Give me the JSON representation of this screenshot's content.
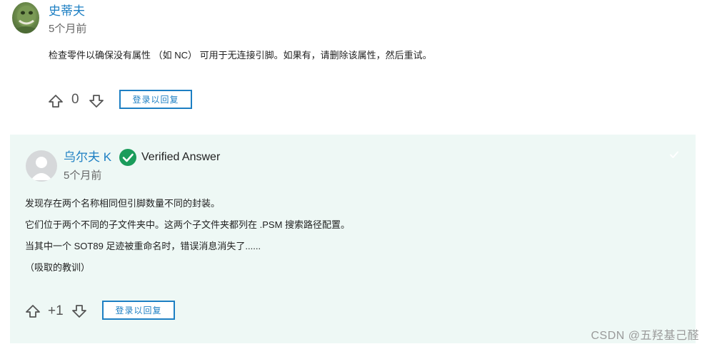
{
  "post1": {
    "author": "史蒂夫",
    "time": "5个月前",
    "body": "检查零件以确保没有属性 （如 NC） 可用于无连接引脚。如果有，请删除该属性，然后重试。",
    "votes": "0",
    "reply_label": "登录以回复"
  },
  "post2": {
    "author": "乌尔夫 K",
    "verified_label": "Verified Answer",
    "time": "5个月前",
    "lines": [
      "发现存在两个名称相同但引脚数量不同的封装。",
      "它们位于两个不同的子文件夹中。这两个子文件夹都列在 .PSM 搜索路径配置。",
      "当其中一个 SOT89 足迹被重命名时，错误消息消失了......",
      "（吸取的教训）"
    ],
    "votes": "+1",
    "reply_label": "登录以回复"
  },
  "watermark": "CSDN @五羟基己醛",
  "colors": {
    "link_blue": "#1d7fc3",
    "verified_green": "#1a9c5b",
    "answer_bg": "#eef8f5"
  },
  "icons": [
    "avatar-dinosaur",
    "upvote-arrow-icon",
    "downvote-arrow-icon",
    "verified-check-icon",
    "default-avatar-icon",
    "corner-check-icon"
  ]
}
